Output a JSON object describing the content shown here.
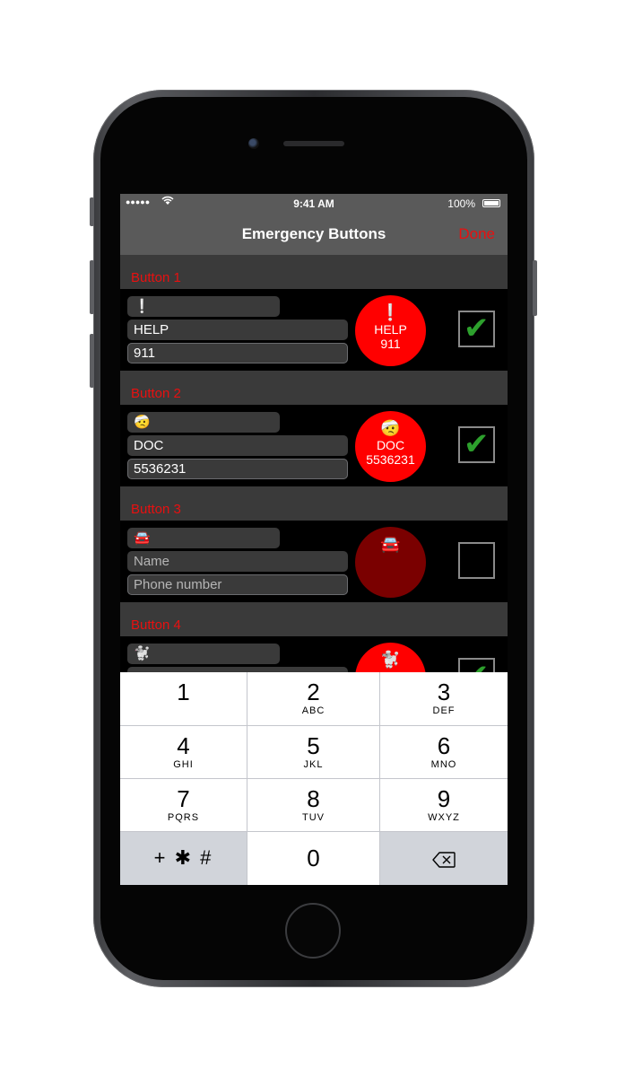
{
  "status_bar": {
    "time": "9:41 AM",
    "battery": "100%",
    "signal": "●●●●●",
    "wifi": "wifi-icon"
  },
  "nav": {
    "title": "Emergency Buttons",
    "done_label": "Done"
  },
  "buttons": [
    {
      "header": "Button 1",
      "emoji": "❕",
      "name": "HELP",
      "phone": "911",
      "preview_emoji": "❕",
      "preview_name": "HELP",
      "preview_phone": "911",
      "enabled": true,
      "checkmark": "✔"
    },
    {
      "header": "Button 2",
      "emoji": "🤕",
      "name": "DOC",
      "phone": "5536231",
      "preview_emoji": "🤕",
      "preview_name": "DOC",
      "preview_phone": "5536231",
      "enabled": true,
      "checkmark": "✔"
    },
    {
      "header": "Button 3",
      "emoji": "🚘",
      "name_placeholder": "Name",
      "phone_placeholder": "Phone number",
      "preview_emoji": "🚘",
      "enabled": false
    },
    {
      "header": "Button 4",
      "emoji": "🐩",
      "preview_emoji": "🐩",
      "enabled": true,
      "checkmark": "✔"
    }
  ],
  "keypad": {
    "keys": [
      {
        "digit": "1",
        "letters": ""
      },
      {
        "digit": "2",
        "letters": "ABC"
      },
      {
        "digit": "3",
        "letters": "DEF"
      },
      {
        "digit": "4",
        "letters": "GHI"
      },
      {
        "digit": "5",
        "letters": "JKL"
      },
      {
        "digit": "6",
        "letters": "MNO"
      },
      {
        "digit": "7",
        "letters": "PQRS"
      },
      {
        "digit": "8",
        "letters": "TUV"
      },
      {
        "digit": "9",
        "letters": "WXYZ"
      }
    ],
    "symbols_label": "+ ✱ #",
    "zero": "0",
    "delete_icon": "⌫"
  },
  "colors": {
    "accent": "#e81010",
    "preview_active": "#ff0000",
    "preview_inactive": "#7a0000",
    "check": "#2da02d"
  }
}
